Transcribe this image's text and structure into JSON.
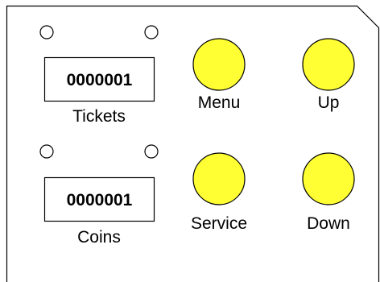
{
  "counters": {
    "tickets": {
      "value": "0000001",
      "label": "Tickets"
    },
    "coins": {
      "value": "0000001",
      "label": "Coins"
    }
  },
  "buttons": {
    "menu": {
      "label": "Menu"
    },
    "up": {
      "label": "Up"
    },
    "service": {
      "label": "Service"
    },
    "down": {
      "label": "Down"
    }
  },
  "colors": {
    "button_fill": "#ffff33",
    "outline": "#000000",
    "background": "#ffffff"
  }
}
